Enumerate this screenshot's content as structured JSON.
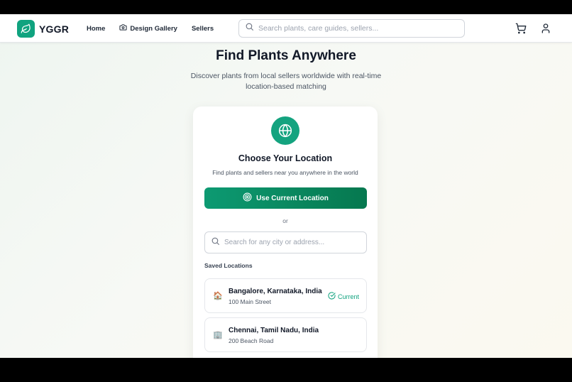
{
  "header": {
    "logo_text": "YGGR",
    "nav": [
      {
        "label": "Home",
        "icon": null
      },
      {
        "label": "Design Gallery",
        "icon": "camera-icon"
      },
      {
        "label": "Sellers",
        "icon": null
      }
    ],
    "search_placeholder": "Search plants, care guides, sellers...",
    "icons": [
      "cart-icon",
      "user-icon"
    ]
  },
  "hero": {
    "title": "Find Plants Anywhere",
    "subtitle": "Discover plants from local sellers worldwide with real-time location-based matching"
  },
  "location_card": {
    "icon": "globe-icon",
    "title": "Choose Your Location",
    "subtitle": "Find plants and sellers near you anywhere in the world",
    "use_current_label": "Use Current Location",
    "or_text": "or",
    "search_placeholder": "Search for any city or address...",
    "saved_label": "Saved Locations",
    "saved_locations": [
      {
        "icon": "🏠",
        "name": "Bangalore, Karnataka, India",
        "address": "100 Main Street",
        "badge": "Current"
      },
      {
        "icon": "🏢",
        "name": "Chennai, Tamil Nadu, India",
        "address": "200 Beach Road",
        "badge": ""
      }
    ]
  },
  "colors": {
    "brand": "#10a37f",
    "button_start": "#0d9a72",
    "button_end": "#06784f"
  }
}
